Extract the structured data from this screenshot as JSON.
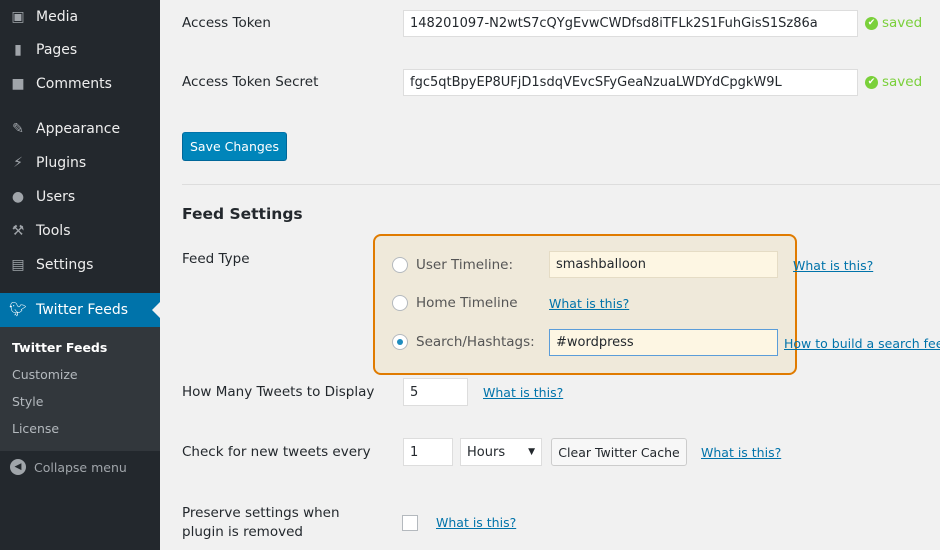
{
  "sidebar": {
    "items": [
      {
        "label": "Media",
        "icon": "media-icon"
      },
      {
        "label": "Pages",
        "icon": "pages-icon"
      },
      {
        "label": "Comments",
        "icon": "comments-icon"
      },
      {
        "label": "Appearance",
        "icon": "appearance-icon"
      },
      {
        "label": "Plugins",
        "icon": "plugins-icon"
      },
      {
        "label": "Users",
        "icon": "users-icon"
      },
      {
        "label": "Tools",
        "icon": "tools-icon"
      },
      {
        "label": "Settings",
        "icon": "settings-icon"
      },
      {
        "label": "Twitter Feeds",
        "icon": "twitter-icon"
      }
    ],
    "submenu": [
      "Twitter Feeds",
      "Customize",
      "Style",
      "License"
    ],
    "collapse": "Collapse menu"
  },
  "auth": {
    "token_label": "Access Token",
    "token_value": "148201097-N2wtS7cQYgEvwCWDfsd8iTFLk2S1FuhGisS1Sz86a",
    "secret_label": "Access Token Secret",
    "secret_value": "fgc5qtBpyEP8UFjD1sdqVEvcSFyGeaNzuaLWDYdCpgkW9L",
    "saved": "saved",
    "save_button": "Save Changes"
  },
  "feed": {
    "heading": "Feed Settings",
    "type_label": "Feed Type",
    "user_timeline": "User Timeline:",
    "user_value": "smashballoon",
    "home_timeline": "Home Timeline",
    "search": "Search/Hashtags:",
    "search_value": "#wordpress",
    "what": "What is this?",
    "how_search": "How to build a search feed",
    "num_label": "How Many Tweets to Display",
    "num_value": "5",
    "check_label": "Check for new tweets every",
    "check_value": "1",
    "check_unit": "Hours",
    "clear_cache": "Clear Twitter Cache",
    "preserve_label_1": "Preserve settings when",
    "preserve_label_2": "plugin is removed"
  },
  "colors": {
    "accent": "#0073aa",
    "highlight": "#e07b00",
    "saved": "#7ad03a"
  }
}
